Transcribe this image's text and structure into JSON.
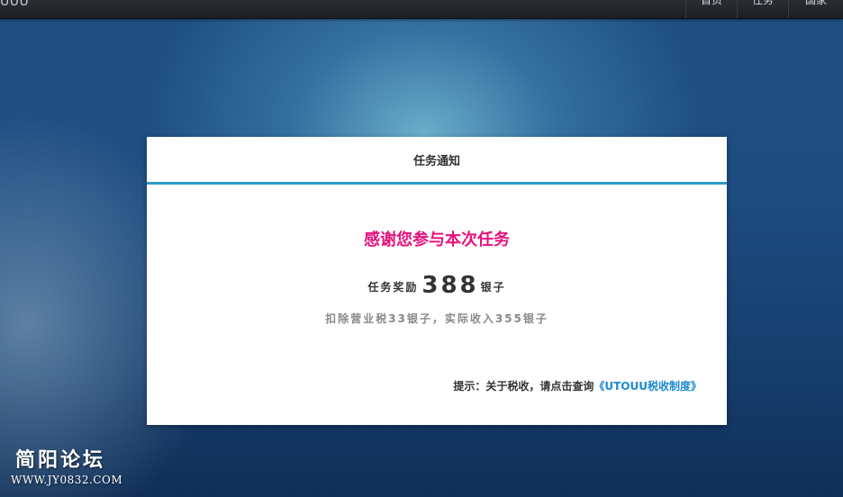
{
  "topbar": {
    "brand": "UUU",
    "nav": [
      {
        "label": "首页"
      },
      {
        "label": "任务"
      },
      {
        "label": "国家"
      }
    ]
  },
  "panel": {
    "title": "任务通知",
    "thanks": "感谢您参与本次任务",
    "reward_prefix": "任务奖励",
    "reward_amount": "388",
    "reward_unit": "银子",
    "tax_line": "扣除营业税33银子，实际收入355银子",
    "tip_prefix": "提示：关于税收，请点击查询",
    "tip_link": "《UTOUU税收制度》"
  },
  "watermark": {
    "title": "简阳论坛",
    "url": "WWW.JY0832.COM"
  },
  "colors": {
    "accent": "#2a9cc8",
    "thanks": "#e5127d",
    "link": "#1d8ad0"
  }
}
